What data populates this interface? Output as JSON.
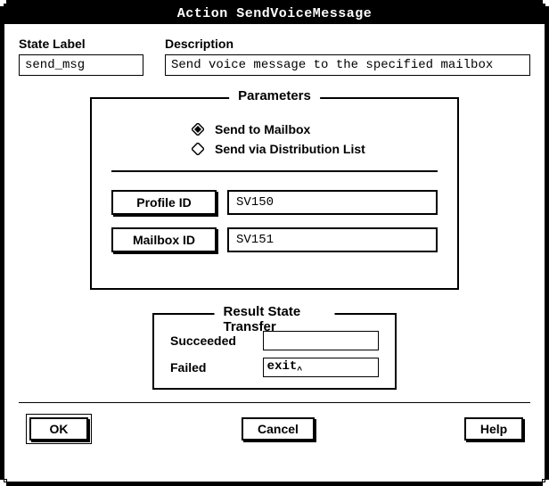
{
  "title": "Action SendVoiceMessage",
  "state_label_caption": "State Label",
  "state_label_value": "send_msg",
  "description_caption": "Description",
  "description_value": "Send voice message to the specified mailbox",
  "parameters": {
    "legend": "Parameters",
    "radio_mailbox": "Send to Mailbox",
    "radio_distlist": "Send via Distribution List",
    "radio_selected": "mailbox",
    "profile_id_label": "Profile ID",
    "profile_id_value": "SV150",
    "mailbox_id_label": "Mailbox ID",
    "mailbox_id_value": "SV151"
  },
  "result": {
    "legend": "Result State Transfer",
    "succeeded_label": "Succeeded",
    "succeeded_value": "",
    "failed_label": "Failed",
    "failed_value": "exit"
  },
  "buttons": {
    "ok": "OK",
    "cancel": "Cancel",
    "help": "Help"
  }
}
